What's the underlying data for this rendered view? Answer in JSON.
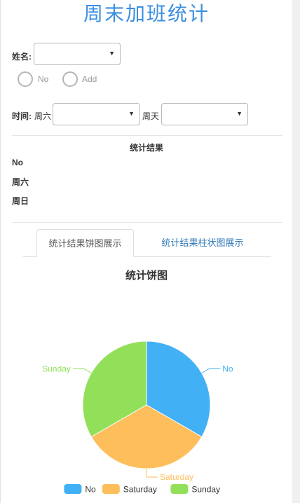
{
  "page_title": "周末加班统计",
  "form": {
    "name_label": "姓名:",
    "name_value": "",
    "radios": [
      {
        "label": "No",
        "checked": false
      },
      {
        "label": "Add",
        "checked": false
      }
    ],
    "time_label": "时间:",
    "saturday_label": "周六",
    "saturday_value": "",
    "sunday_label": "周天",
    "sunday_value": ""
  },
  "results": {
    "title": "统计结果",
    "rows": [
      "No",
      "周六",
      "周日"
    ]
  },
  "tabs": [
    {
      "label": "统计结果饼图展示",
      "active": true
    },
    {
      "label": "统计结果柱状图展示",
      "active": false
    }
  ],
  "chart_data": {
    "type": "pie",
    "title": "统计饼图",
    "legend_position": "bottom",
    "slices": [
      {
        "name": "No",
        "value": 1,
        "color": "#42b0f5"
      },
      {
        "name": "Saturday",
        "value": 1,
        "color": "#ffbe5c"
      },
      {
        "name": "Sunday",
        "value": 1,
        "color": "#92e05a"
      }
    ]
  }
}
